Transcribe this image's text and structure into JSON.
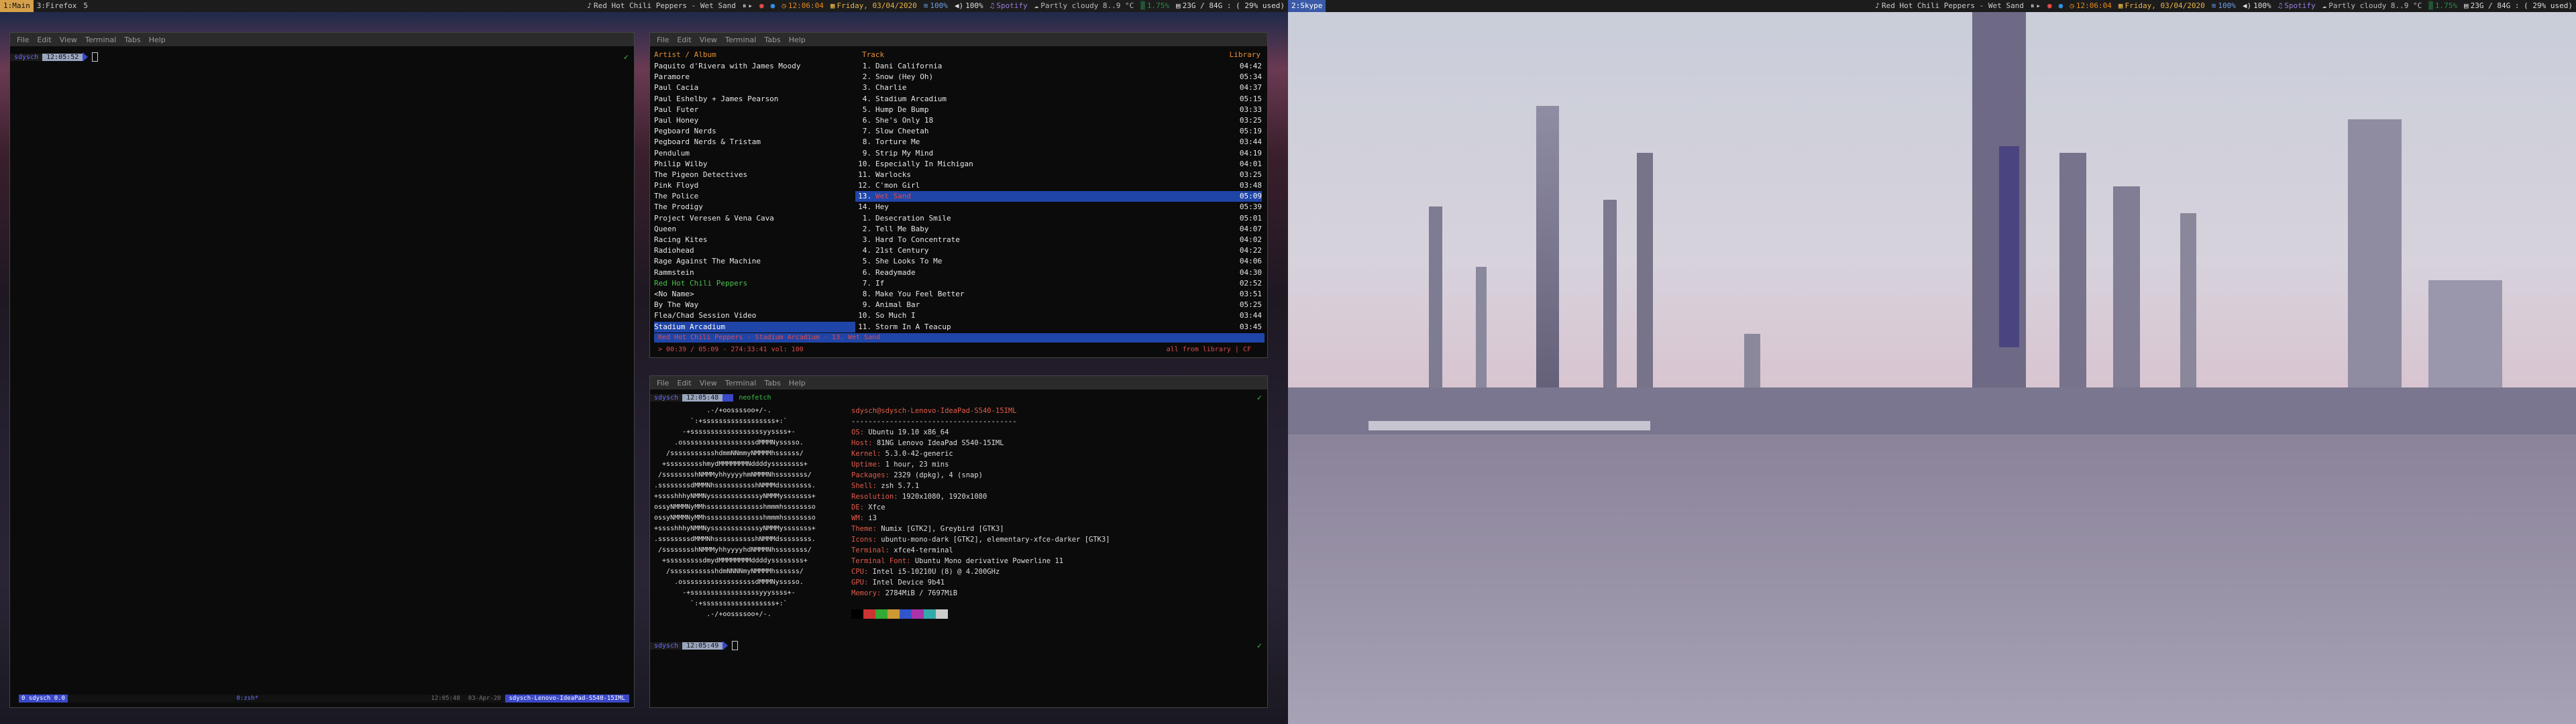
{
  "left_bar": {
    "workspaces": [
      "1:Main",
      "3:Firefox",
      "5"
    ],
    "now_playing": "Red Hot Chili Peppers - Wet Sand",
    "clock": "12:06:04",
    "date": "Friday, 03/04/2020",
    "net": "100%",
    "volume": "100%",
    "spotify": "Spotify",
    "weather": "Partly cloudy 8..9 °C",
    "cpu": "1.75%",
    "mem": "23G / 84G : ( 29% used)"
  },
  "right_bar": {
    "workspace": "2:Skype",
    "now_playing": "Red Hot Chili Peppers - Wet Sand",
    "clock": "12:06:04",
    "date": "Friday, 03/04/2020",
    "net": "100%",
    "volume": "100%",
    "spotify": "Spotify",
    "weather": "Partly cloudy 8..9 °C",
    "cpu": "1.75%",
    "mem": "23G / 84G : ( 29% used)"
  },
  "menu": [
    "File",
    "Edit",
    "View",
    "Terminal",
    "Tabs",
    "Help"
  ],
  "term_left": {
    "user": "sdysch",
    "time": "12:05:52",
    "status_left": "0  sdysch  0.0",
    "status_mid": "0:zsh*",
    "status_right_time": "12:05:48",
    "status_right_date": "03-Apr-20",
    "status_host": "sdysch-Lenovo-IdeaPad-S540-15IML"
  },
  "cmus": {
    "col_artist": "Artist / Album",
    "col_track": "Track",
    "col_library": "Library",
    "artists": [
      "Paquito d'Rivera with James Moody",
      "Paramore",
      "Paul Cacia",
      "Paul Eshelby + James Pearson",
      "Paul Futer",
      "Paul Honey",
      "Pegboard Nerds",
      "Pegboard Nerds & Tristam",
      "Pendulum",
      "Philip Wilby",
      "The Pigeon Detectives",
      "Pink Floyd",
      "The Police",
      "The Prodigy",
      "Project Veresen & Vena Cava",
      "Queen",
      "Racing Kites",
      "Radiohead",
      "Rage Against The Machine",
      "Rammstein",
      "Red Hot Chili Peppers",
      "  <No Name>",
      "  By The Way",
      "  Flea/Chad Session Video",
      "  Stadium Arcadium"
    ],
    "tracks": [
      {
        "n": "1.",
        "t": "Dani California",
        "d": "04:42"
      },
      {
        "n": "2.",
        "t": "Snow (Hey Oh)",
        "d": "05:34"
      },
      {
        "n": "3.",
        "t": "Charlie",
        "d": "04:37"
      },
      {
        "n": "4.",
        "t": "Stadium Arcadium",
        "d": "05:15"
      },
      {
        "n": "5.",
        "t": "Hump De Bump",
        "d": "03:33"
      },
      {
        "n": "6.",
        "t": "She's Only 18",
        "d": "03:25"
      },
      {
        "n": "7.",
        "t": "Slow Cheetah",
        "d": "05:19"
      },
      {
        "n": "8.",
        "t": "Torture Me",
        "d": "03:44"
      },
      {
        "n": "9.",
        "t": "Strip My Mind",
        "d": "04:19"
      },
      {
        "n": "10.",
        "t": "Especially In Michigan",
        "d": "04:01"
      },
      {
        "n": "11.",
        "t": "Warlocks",
        "d": "03:25"
      },
      {
        "n": "12.",
        "t": "C'mon Girl",
        "d": "03:48"
      },
      {
        "n": "13.",
        "t": "Wet Sand",
        "d": "05:09"
      },
      {
        "n": "14.",
        "t": "Hey",
        "d": "05:39"
      },
      {
        "n": "1.",
        "t": "Desecration Smile",
        "d": "05:01"
      },
      {
        "n": "2.",
        "t": "Tell Me Baby",
        "d": "04:07"
      },
      {
        "n": "3.",
        "t": "Hard To Concentrate",
        "d": "04:02"
      },
      {
        "n": "4.",
        "t": "21st Century",
        "d": "04:22"
      },
      {
        "n": "5.",
        "t": "She Looks To Me",
        "d": "04:06"
      },
      {
        "n": "6.",
        "t": "Readymade",
        "d": "04:30"
      },
      {
        "n": "7.",
        "t": "If",
        "d": "02:52"
      },
      {
        "n": "8.",
        "t": "Make You Feel Better",
        "d": "03:51"
      },
      {
        "n": "9.",
        "t": "Animal Bar",
        "d": "05:25"
      },
      {
        "n": "10.",
        "t": "So Much I",
        "d": "03:44"
      },
      {
        "n": "11.",
        "t": "Storm In A Teacup",
        "d": "03:45"
      }
    ],
    "now_line": "Red Hot Chili Peppers - Stadium Arcadium - 13. Wet Sand",
    "progress": "> 00:39 / 05:09 - 274:33:41 vol: 100",
    "progress_right": "all from library | CF"
  },
  "neofetch": {
    "user": "sdysch",
    "time": "12:05:48",
    "cmd": "neofetch",
    "title": "sdysch@sdysch-Lenovo-IdeaPad-S540-15IML",
    "dashes": "---------------------------------------",
    "info": [
      {
        "k": "OS:",
        "v": " Ubuntu 19.10 x86_64"
      },
      {
        "k": "Host:",
        "v": " 81NG Lenovo IdeaPad S540-15IML"
      },
      {
        "k": "Kernel:",
        "v": " 5.3.0-42-generic"
      },
      {
        "k": "Uptime:",
        "v": " 1 hour, 23 mins"
      },
      {
        "k": "Packages:",
        "v": " 2329 (dpkg), 4 (snap)"
      },
      {
        "k": "Shell:",
        "v": " zsh 5.7.1"
      },
      {
        "k": "Resolution:",
        "v": " 1920x1080, 1920x1080"
      },
      {
        "k": "DE:",
        "v": " Xfce"
      },
      {
        "k": "WM:",
        "v": " i3"
      },
      {
        "k": "Theme:",
        "v": " Numix [GTK2], Greybird [GTK3]"
      },
      {
        "k": "Icons:",
        "v": " ubuntu-mono-dark [GTK2], elementary-xfce-darker [GTK3]"
      },
      {
        "k": "Terminal:",
        "v": " xfce4-terminal"
      },
      {
        "k": "Terminal Font:",
        "v": " Ubuntu Mono derivative Powerline 11"
      },
      {
        "k": "CPU:",
        "v": " Intel i5-10210U (8) @ 4.200GHz"
      },
      {
        "k": "GPU:",
        "v": " Intel Device 9b41"
      },
      {
        "k": "Memory:",
        "v": " 2784MiB / 7697MiB"
      }
    ],
    "palette": [
      "#000000",
      "#cc3333",
      "#33aa33",
      "#cc9933",
      "#3355cc",
      "#aa33aa",
      "#33aaaa",
      "#cccccc"
    ],
    "ascii": [
      "             .-/+oossssoo+/-.",
      "         `:+ssssssssssssssssss+:`",
      "       -+ssssssssssssssssssyyssss+-",
      "     .ossssssssssssssssssdMMMNysssso.",
      "   /ssssssssssshdmmNNmmyNMMMMhssssss/",
      "  +ssssssssshmydMMMMMMMNddddyssssssss+",
      " /sssssssshNMMMyhhyyyyhmNMMMNhssssssss/",
      ".ssssssssdMMMNhsssssssssshNMMMdssssssss.",
      "+sssshhhyNMMNyssssssssssssyNMMMysssssss+",
      "ossyNMMMNyMMhsssssssssssssshmmmhssssssso",
      "ossyNMMMNyMMhsssssssssssssshmmmhssssssso",
      "+sssshhhyNMMNyssssssssssssyNMMMysssssss+",
      ".ssssssssdMMMNhsssssssssshNMMMdssssssss.",
      " /sssssssshNMMMyhhyyyyhdNMMMNhssssssss/",
      "  +sssssssssdmydMMMMMMMMddddyssssssss+",
      "   /ssssssssssshdmNNNNmyNMMMMhssssss/",
      "     .ossssssssssssssssssdMMMNysssso.",
      "       -+sssssssssssssssssyyyssss+-",
      "         `:+ssssssssssssssssss+:`",
      "             .-/+oossssoo+/-."
    ],
    "prompt2_time": "12:05:49"
  }
}
